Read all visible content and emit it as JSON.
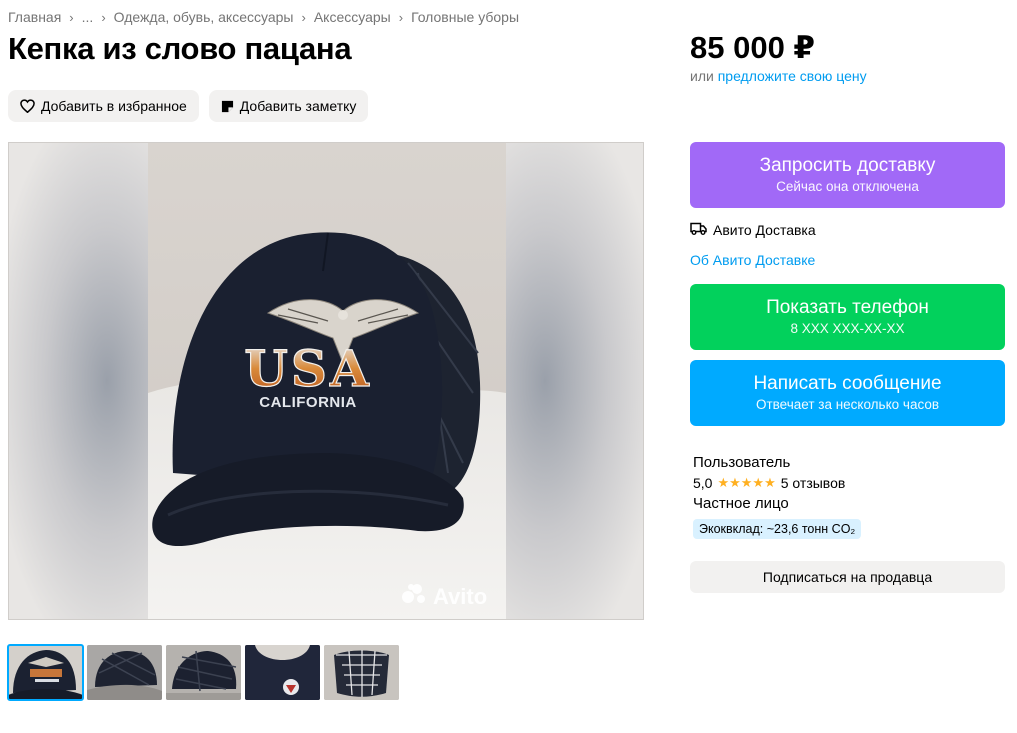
{
  "breadcrumb": {
    "items": [
      "Главная",
      "...",
      "Одежда, обувь, аксессуары",
      "Аксессуары",
      "Головные уборы"
    ]
  },
  "listing": {
    "title": "Кепка из слово пацана",
    "price": "85 000 ₽",
    "offer_prefix": "или",
    "offer_link": "предложите свою цену"
  },
  "actions": {
    "favorite_label": "Добавить в избранное",
    "note_label": "Добавить заметку"
  },
  "gallery": {
    "watermark": "Avito",
    "cap_text_main": "USA",
    "cap_text_sub": "CALIFORNIA",
    "thumbnails_count_visible": 5
  },
  "delivery": {
    "button_main": "Запросить доставку",
    "button_sub": "Сейчас она отключена",
    "service_name": "Авито Доставка",
    "about_link": "Об Авито Доставке"
  },
  "contact": {
    "phone_main": "Показать телефон",
    "phone_sub": "8 XXX XXX-XX-XX",
    "message_main": "Написать сообщение",
    "message_sub": "Отвечает за несколько часов"
  },
  "seller": {
    "name": "Пользователь",
    "rating": "5,0",
    "stars": "★★★★★",
    "reviews": "5 отзывов",
    "type": "Частное лицо",
    "eco": "Экоквклад: ~23,6 тонн CO₂",
    "subscribe_label": "Подписаться на продавца"
  },
  "colors": {
    "delivery_button": "#a169f7",
    "phone_button": "#02d15c",
    "message_button": "#00aaff",
    "link": "#009cf0",
    "star": "#ffb021"
  }
}
